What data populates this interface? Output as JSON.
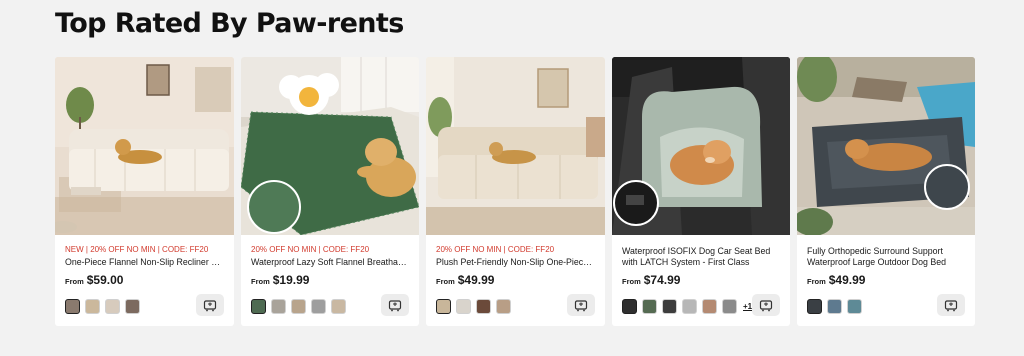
{
  "section": {
    "title": "Top Rated By Paw-rents"
  },
  "colors": {
    "promo": "#d23b2e",
    "background": "#f2f2f2",
    "card": "#ffffff"
  },
  "products": [
    {
      "promo": "NEW | 20% OFF NO MIN | CODE: FF20",
      "name": "One-Piece Flannel Non-Slip Recliner Sofa Cover",
      "from": "From",
      "price": "$59.00",
      "swatches": [
        "#8a7a6e",
        "#cbb89c",
        "#d7cbbd",
        "#7c6a5f"
      ],
      "image": "dog-on-beige-recliner-sofa"
    },
    {
      "promo": "20% OFF NO MIN | CODE: FF20",
      "name": "Waterproof Lazy Soft Flannel Breathable Couch Cover",
      "from": "From",
      "price": "$19.99",
      "swatches": [
        "#4f6b52",
        "#a9a39a",
        "#b8a48c",
        "#9e9e9e",
        "#c9b8a2"
      ],
      "image": "dog-on-green-couch-cover"
    },
    {
      "promo": "20% OFF NO MIN | CODE: FF20",
      "name": "Plush Pet-Friendly Non-Slip One-Piece Sofa Cover",
      "from": "From",
      "price": "$49.99",
      "swatches": [
        "#c8b69a",
        "#d9d4cc",
        "#6b4a3a",
        "#b89e86"
      ],
      "image": "dog-on-cream-sofa"
    },
    {
      "promo": "",
      "name": "Waterproof ISOFIX Dog Car Seat Bed with LATCH System - First Class",
      "from": "From",
      "price": "$74.99",
      "swatches": [
        "#2f2f2f",
        "#556b52",
        "#3d3d3d",
        "#b7b7b7",
        "#b48a72",
        "#8b8b8b"
      ],
      "more": "+1",
      "image": "shiba-in-car-seat-bed"
    },
    {
      "promo": "",
      "name": "Fully Orthopedic Surround Support Waterproof Large Outdoor Dog Bed",
      "from": "From",
      "price": "$49.99",
      "swatches": [
        "#3a3f44",
        "#5e7a8f",
        "#5e8a96"
      ],
      "image": "dog-on-outdoor-bed-by-pool"
    }
  ]
}
